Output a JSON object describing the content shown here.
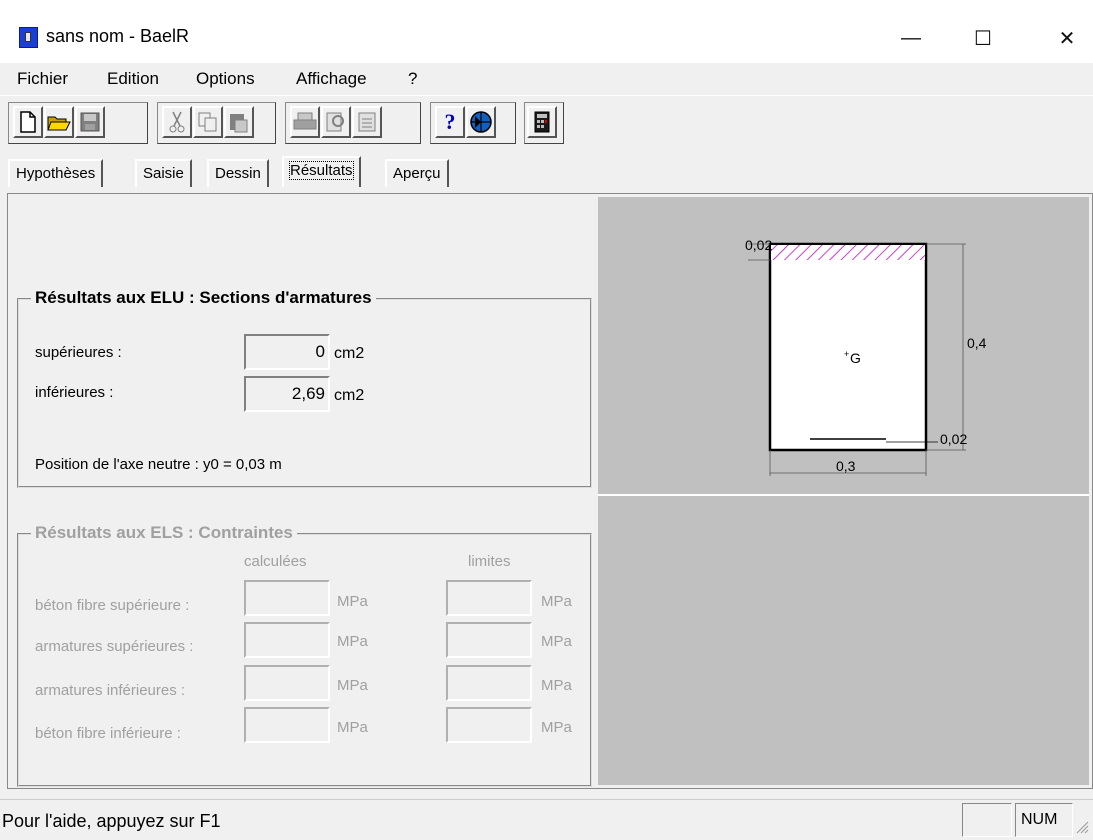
{
  "window": {
    "title": "sans nom - BaelR",
    "controls": {
      "minimize": "—",
      "maximize": "☐",
      "close": "✕"
    }
  },
  "menu": [
    "Fichier",
    "Edition",
    "Options",
    "Affichage",
    "?"
  ],
  "toolbar": {
    "icons": [
      "new-file-icon",
      "open-folder-icon",
      "save-icon",
      "cut-icon",
      "copy-icon",
      "paste-icon",
      "print-icon",
      "print-preview-icon",
      "page-setup-icon",
      "help-icon",
      "globe-icon",
      "calculator-icon"
    ]
  },
  "tabs": [
    {
      "label": "Hypothèses"
    },
    {
      "label": "Saisie"
    },
    {
      "label": "Dessin"
    },
    {
      "label": "Résultats",
      "active": true
    },
    {
      "label": "Aperçu"
    }
  ],
  "elu": {
    "legend": "Résultats aux ELU : Sections d'armatures",
    "superieures": {
      "label": "supérieures :",
      "value": "0",
      "unit": "cm2"
    },
    "inferieures": {
      "label": "inférieures :",
      "value": "2,69",
      "unit": "cm2"
    },
    "axe_neutre": "Position de l'axe neutre : y0 = 0,03 m"
  },
  "els": {
    "legend": "Résultats aux ELS : Contraintes",
    "col_calculees": "calculées",
    "col_limites": "limites",
    "unit": "MPa",
    "rows": [
      {
        "label": "béton fibre supérieure :",
        "calculee": "",
        "limite": ""
      },
      {
        "label": "armatures supérieures :",
        "calculee": "",
        "limite": ""
      },
      {
        "label": "armatures inférieures :",
        "calculee": "",
        "limite": ""
      },
      {
        "label": "béton fibre inférieure :",
        "calculee": "",
        "limite": ""
      }
    ]
  },
  "drawing": {
    "top_dim": "0,02",
    "height_dim": "0,4",
    "bottom_dim": "0,02",
    "width_dim": "0,3",
    "centroid": "G",
    "hatch_color": "#c000c0"
  },
  "status": {
    "help": "Pour l'aide, appuyez sur F1",
    "num": "NUM"
  }
}
